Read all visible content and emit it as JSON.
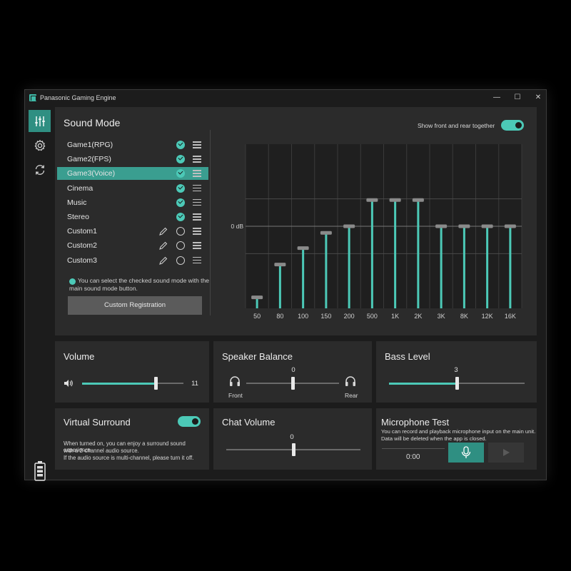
{
  "window": {
    "title": "Panasonic Gaming Engine",
    "controls": {
      "minimize": "—",
      "maximize": "☐",
      "close": "✕"
    }
  },
  "sidebar": {
    "items": [
      {
        "name": "equalizer",
        "icon": "sliders-icon",
        "active": true
      },
      {
        "name": "settings",
        "icon": "gear-icon",
        "active": false
      },
      {
        "name": "sync",
        "icon": "refresh-icon",
        "active": false
      }
    ],
    "battery_icon": "battery-icon"
  },
  "sound_mode": {
    "title": "Sound Mode",
    "show_front_rear_label": "Show front and rear together",
    "show_front_rear_on": true,
    "modes": [
      {
        "label": "Game1(RPG)",
        "checked": true,
        "editable": false,
        "selected": false
      },
      {
        "label": "Game2(FPS)",
        "checked": true,
        "editable": false,
        "selected": false
      },
      {
        "label": "Game3(Voice)",
        "checked": true,
        "editable": false,
        "selected": true
      },
      {
        "label": "Cinema",
        "checked": true,
        "editable": false,
        "selected": false
      },
      {
        "label": "Music",
        "checked": true,
        "editable": false,
        "selected": false
      },
      {
        "label": "Stereo",
        "checked": true,
        "editable": false,
        "selected": false
      },
      {
        "label": "Custom1",
        "checked": false,
        "editable": true,
        "selected": false
      },
      {
        "label": "Custom2",
        "checked": false,
        "editable": true,
        "selected": false
      },
      {
        "label": "Custom3",
        "checked": false,
        "editable": true,
        "selected": false
      }
    ],
    "note": "You can select the checked sound mode with the main sound mode button.",
    "custom_registration_label": "Custom Registration"
  },
  "equalizer": {
    "zero_label": "0 dB",
    "bands": [
      "50",
      "80",
      "100",
      "150",
      "200",
      "500",
      "1K",
      "2K",
      "3K",
      "8K",
      "12K",
      "16K"
    ],
    "levels": [
      -6.5,
      -3.5,
      -2.0,
      -0.6,
      0.0,
      2.4,
      2.4,
      2.4,
      0.0,
      0.0,
      0.0,
      0.0
    ],
    "range": [
      -7.5,
      7.5
    ]
  },
  "volume": {
    "title": "Volume",
    "value": 11,
    "max": 15,
    "fraction": 0.73,
    "icon": "speaker-icon"
  },
  "speaker_balance": {
    "title": "Speaker Balance",
    "value": "0",
    "fraction": 0.5,
    "front_label": "Front",
    "rear_label": "Rear",
    "icon": "headphones-icon"
  },
  "bass_level": {
    "title": "Bass Level",
    "value": "3",
    "fraction": 0.5
  },
  "virtual_surround": {
    "title": "Virtual Surround",
    "on": true,
    "desc1": "When turned on, you can enjoy a surround sound experience",
    "desc2": "with a 2-channel audio source.",
    "desc3": "If the audio source is multi-channel, please turn it off."
  },
  "chat_volume": {
    "title": "Chat Volume",
    "value": "0",
    "fraction": 0.5
  },
  "microphone_test": {
    "title": "Microphone Test",
    "desc1": "You can record and playback microphone input on the main unit.",
    "desc2": "Data will be deleted when the app is closed.",
    "time": "0:00",
    "record_icon": "microphone-icon",
    "play_icon": "play-icon"
  },
  "colors": {
    "accent": "#4cc9b7",
    "accent_dark": "#2f8f82",
    "panel": "#2b2b2b",
    "window": "#1c1c1c"
  }
}
